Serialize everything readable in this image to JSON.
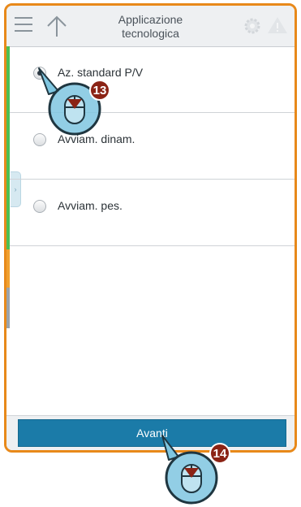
{
  "header": {
    "title": "Applicazione\ntecnologica",
    "menu_icon": "hamburger-menu-icon",
    "up_icon": "arrow-up-icon",
    "settings_icon": "gear-icon",
    "warning_icon": "warning-triangle-icon"
  },
  "options": [
    {
      "label": "Az. standard P/V",
      "selected": true
    },
    {
      "label": "Avviam. dinam.",
      "selected": false
    },
    {
      "label": "Avviam. pes.",
      "selected": false
    }
  ],
  "footer": {
    "next_label": "Avanti"
  },
  "annotations": {
    "step_1": "13",
    "step_2": "14"
  },
  "colors": {
    "accent_border": "#e8891a",
    "button_blue": "#1b7ba8",
    "status_green": "#4cbf52",
    "status_orange": "#f0a030",
    "status_gray": "#9aa3ab",
    "badge_red": "#8b2315",
    "callout_blue": "#7fc6e0"
  }
}
